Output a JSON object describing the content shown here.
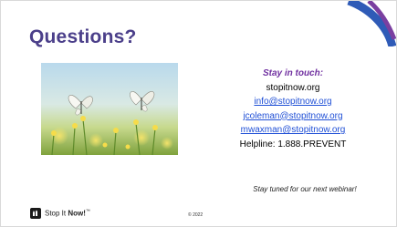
{
  "slide": {
    "title": "Questions?",
    "contact": {
      "heading": "Stay in touch:",
      "website": "stopitnow.org",
      "emails": [
        "info@stopitnow.org",
        "jcoleman@stopitnow.org",
        "mwaxman@stopitnow.org"
      ],
      "helpline": "Helpline: 1.888.PREVENT"
    },
    "footer": {
      "tuned": "Stay tuned for our next webinar!",
      "year": "© 2022",
      "logo_prefix": "Stop It ",
      "logo_bold": "Now!",
      "logo_mark": "™"
    },
    "colors": {
      "title": "#4b3f8a",
      "accent": "#7030a0",
      "link": "#1f4fd6",
      "arc_blue": "#2f5bb7",
      "arc_purple": "#7a3fa0"
    },
    "image": {
      "subject": "two white butterflies on wildflowers"
    }
  }
}
